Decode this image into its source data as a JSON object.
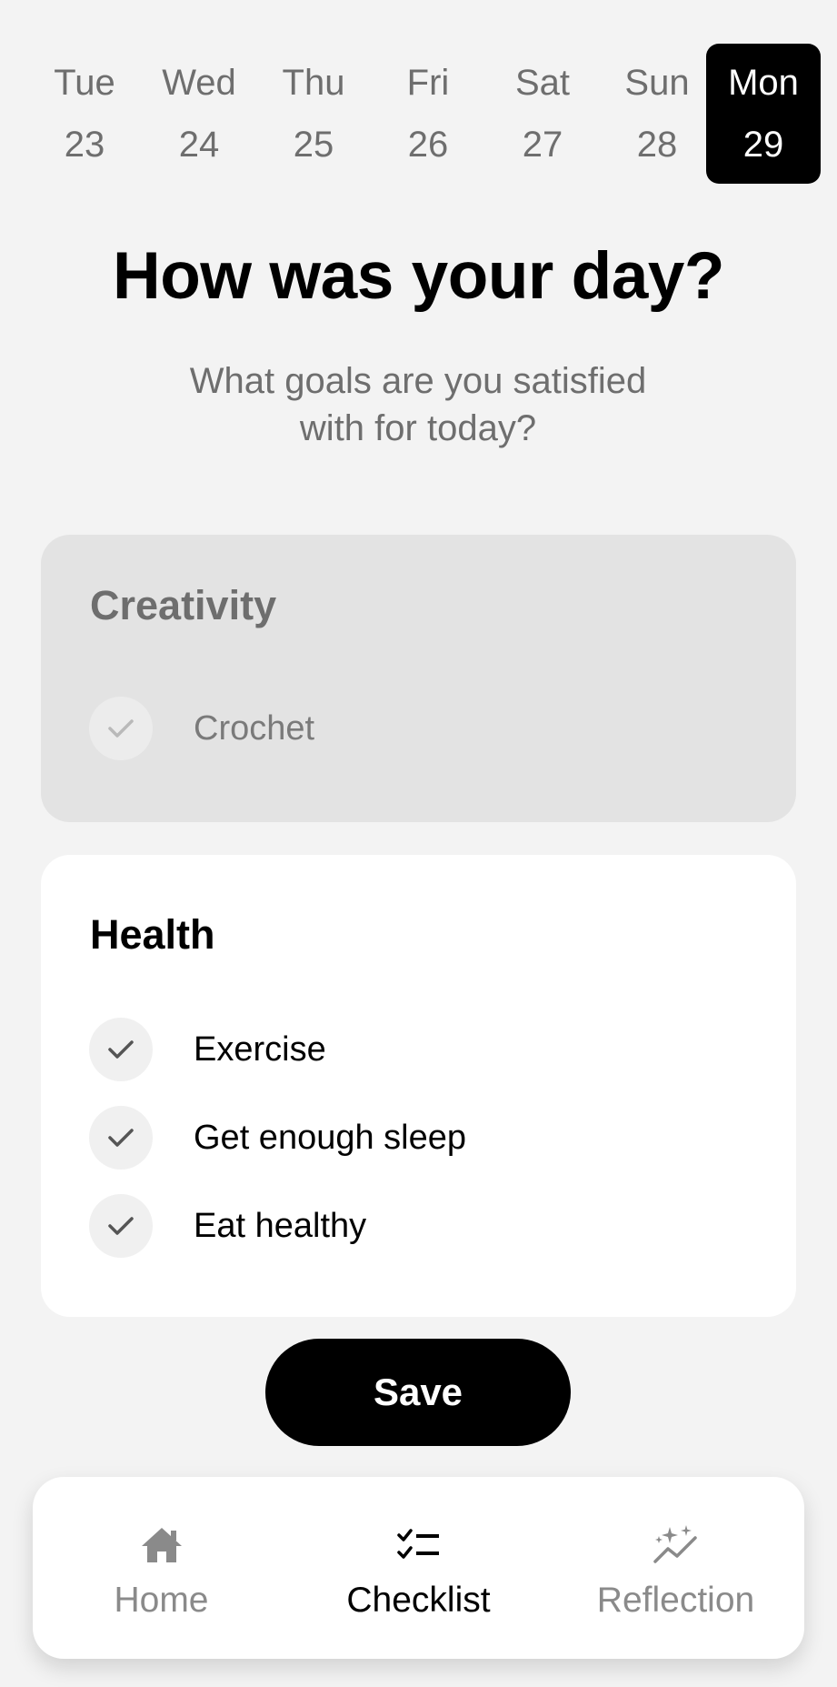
{
  "dates": [
    {
      "dow": "Tue",
      "dom": "23",
      "selected": false
    },
    {
      "dow": "Wed",
      "dom": "24",
      "selected": false
    },
    {
      "dow": "Thu",
      "dom": "25",
      "selected": false
    },
    {
      "dow": "Fri",
      "dom": "26",
      "selected": false
    },
    {
      "dow": "Sat",
      "dom": "27",
      "selected": false
    },
    {
      "dow": "Sun",
      "dom": "28",
      "selected": false
    },
    {
      "dow": "Mon",
      "dom": "29",
      "selected": true
    }
  ],
  "header": {
    "title": "How was your day?",
    "subtitle_line1": "What goals are you satisfied",
    "subtitle_line2": "with for today?"
  },
  "categories": [
    {
      "name": "Creativity",
      "active": false,
      "goals": [
        {
          "label": "Crochet",
          "checked": true
        }
      ]
    },
    {
      "name": "Health",
      "active": true,
      "goals": [
        {
          "label": "Exercise",
          "checked": true
        },
        {
          "label": "Get enough sleep",
          "checked": true
        },
        {
          "label": "Eat healthy",
          "checked": true
        }
      ]
    }
  ],
  "save_label": "Save",
  "nav": [
    {
      "label": "Home",
      "icon": "home-icon",
      "active": false
    },
    {
      "label": "Checklist",
      "icon": "checklist-icon",
      "active": true
    },
    {
      "label": "Reflection",
      "icon": "sparkle-chart-icon",
      "active": false
    }
  ],
  "colors": {
    "background": "#f3f3f3",
    "selected_date_bg": "#000000",
    "muted_text": "#6e6e6e",
    "inactive_card": "#e3e3e3",
    "active_card": "#ffffff",
    "primary_button": "#000000"
  }
}
